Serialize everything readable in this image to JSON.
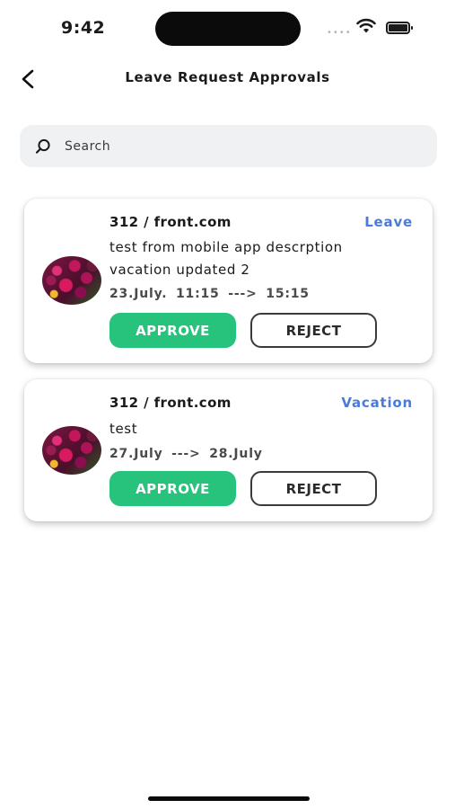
{
  "status_bar": {
    "time": "9:42",
    "signal": "••••"
  },
  "header": {
    "title": "Leave Request Approvals",
    "back_icon": "chevron-left-icon"
  },
  "search": {
    "placeholder": "Search",
    "value": "",
    "icon": "search-icon"
  },
  "requests": [
    {
      "requester": "312 / front.com",
      "type": "Leave",
      "description": "test from mobile app descrption vacation updated 2",
      "dates": "23.July.  11:15  --->  15:15",
      "approve_label": "APPROVE",
      "reject_label": "REJECT"
    },
    {
      "requester": "312 / front.com",
      "type": "Vacation",
      "description": "test",
      "dates": "27.July  --->  28.July",
      "approve_label": "APPROVE",
      "reject_label": "REJECT"
    }
  ],
  "colors": {
    "approve": "#27c27c",
    "type_badge": "#4a7bd8",
    "search_bg": "#eff1f2"
  }
}
